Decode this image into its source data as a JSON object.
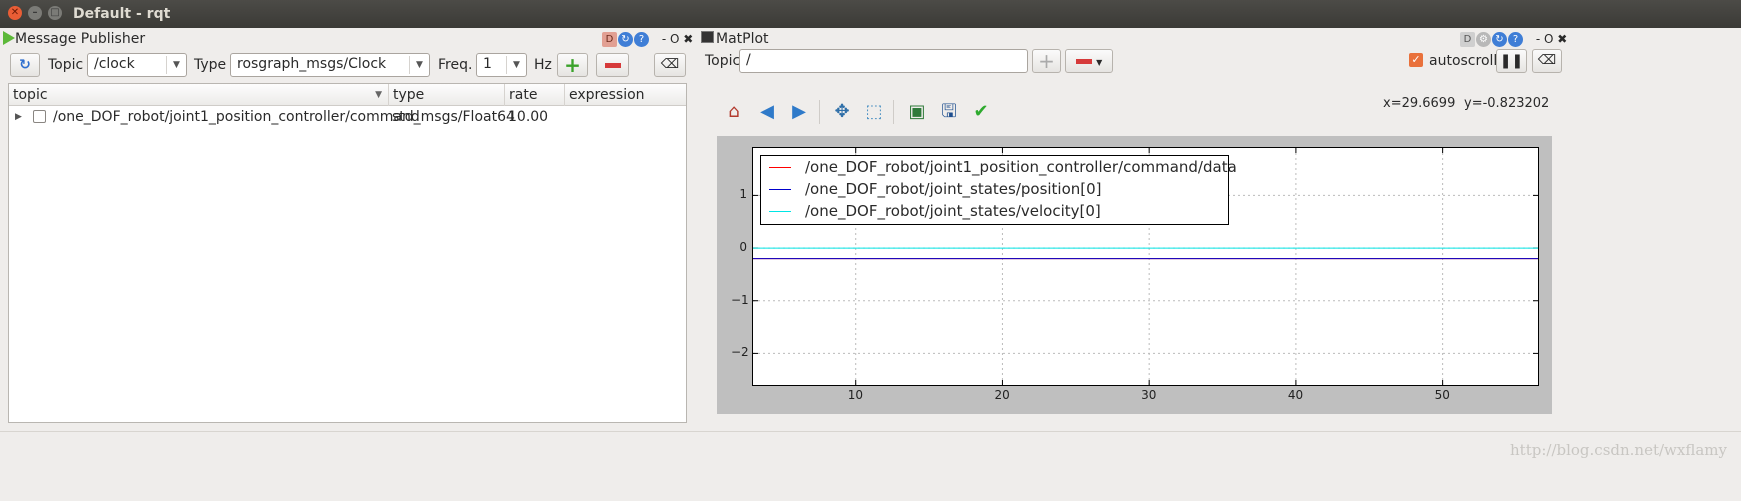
{
  "window": {
    "title": "Default - rqt"
  },
  "publisher": {
    "title": "Message Publisher",
    "topic_label": "Topic",
    "topic_value": "/clock",
    "type_label": "Type",
    "type_value": "rosgraph_msgs/Clock",
    "freq_label": "Freq.",
    "freq_value": "1",
    "hz_label": "Hz",
    "columns": [
      "topic",
      "type",
      "rate",
      "expression"
    ],
    "rows": [
      {
        "topic": "/one_DOF_robot/joint1_position_controller/command",
        "type": "std_msgs/Float64",
        "rate": "10.00",
        "expression": ""
      }
    ],
    "panel_controls": "- O"
  },
  "matplot": {
    "title": "MatPlot",
    "topic_label": "Topic",
    "topic_value": "/",
    "autoscroll_label": "autoscroll",
    "autoscroll_checked": true,
    "coords_x": "x=29.6699",
    "coords_y": "y=-0.823202",
    "panel_controls": "- O",
    "toolbar_icons": [
      "home-icon",
      "back-icon",
      "forward-icon",
      "pan-icon",
      "zoom-icon",
      "subplots-icon",
      "save-icon",
      "check-icon"
    ]
  },
  "chart_data": {
    "type": "line",
    "xlim": [
      3,
      56.5
    ],
    "ylim": [
      -2.6,
      1.9
    ],
    "xticks": [
      10,
      20,
      30,
      40,
      50
    ],
    "yticks": [
      1,
      0,
      -1,
      -2
    ],
    "ytick_labels": [
      "1",
      "0",
      "−1",
      "−2"
    ],
    "grid": true,
    "legend_position": "top-left",
    "series": [
      {
        "name": "/one_DOF_robot/joint1_position_controller/command/data",
        "color": "#ff0000",
        "x": [
          3,
          56.5
        ],
        "y": [
          -0.2,
          -0.2
        ]
      },
      {
        "name": "/one_DOF_robot/joint_states/position[0]",
        "color": "#0000cc",
        "x": [
          3,
          56.5
        ],
        "y": [
          -0.2,
          -0.2
        ]
      },
      {
        "name": "/one_DOF_robot/joint_states/velocity[0]",
        "color": "#00e5e5",
        "x": [
          3,
          56.5
        ],
        "y": [
          0,
          0
        ]
      }
    ]
  },
  "watermark": "http://blog.csdn.net/wxflamy",
  "colors": {
    "titlebar": "#3c3b37",
    "close_button": "#e95d35",
    "accent_green": "#5cb838"
  }
}
